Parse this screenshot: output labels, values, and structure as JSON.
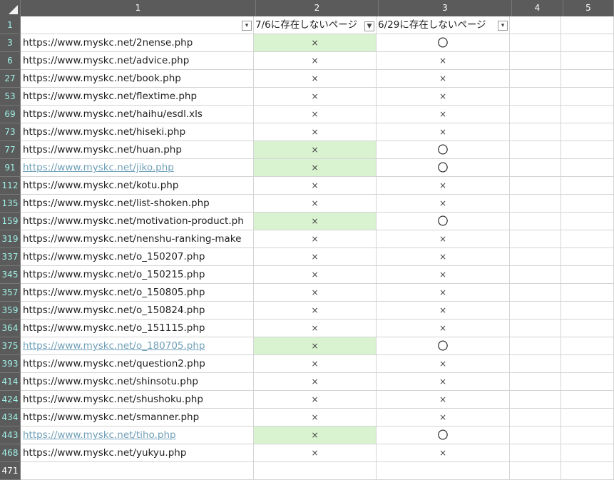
{
  "columns": [
    "1",
    "2",
    "3",
    "4",
    "5"
  ],
  "header_row": {
    "row_num": "1",
    "col2": "7/6に存在しないページ",
    "col3": "6/29に存在しないページ",
    "filter_icon": "▾",
    "filter_active_icon": "▼"
  },
  "rows": [
    {
      "num": "3",
      "url": "https://www.myskc.net/2nense.php",
      "c2": "×",
      "c3": "〇",
      "green": true,
      "link": false
    },
    {
      "num": "6",
      "url": "https://www.myskc.net/advice.php",
      "c2": "×",
      "c3": "×",
      "green": false,
      "link": false
    },
    {
      "num": "27",
      "url": "https://www.myskc.net/book.php",
      "c2": "×",
      "c3": "×",
      "green": false,
      "link": false
    },
    {
      "num": "53",
      "url": "https://www.myskc.net/flextime.php",
      "c2": "×",
      "c3": "×",
      "green": false,
      "link": false
    },
    {
      "num": "69",
      "url": "https://www.myskc.net/haihu/esdl.xls",
      "c2": "×",
      "c3": "×",
      "green": false,
      "link": false
    },
    {
      "num": "73",
      "url": "https://www.myskc.net/hiseki.php",
      "c2": "×",
      "c3": "×",
      "green": false,
      "link": false
    },
    {
      "num": "77",
      "url": "https://www.myskc.net/huan.php",
      "c2": "×",
      "c3": "〇",
      "green": true,
      "link": false
    },
    {
      "num": "91",
      "url": "https://www.myskc.net/jiko.php",
      "c2": "×",
      "c3": "〇",
      "green": true,
      "link": true
    },
    {
      "num": "112",
      "url": "https://www.myskc.net/kotu.php",
      "c2": "×",
      "c3": "×",
      "green": false,
      "link": false
    },
    {
      "num": "135",
      "url": "https://www.myskc.net/list-shoken.php",
      "c2": "×",
      "c3": "×",
      "green": false,
      "link": false
    },
    {
      "num": "159",
      "url": "https://www.myskc.net/motivation-product.ph",
      "c2": "×",
      "c3": "〇",
      "green": true,
      "link": false
    },
    {
      "num": "319",
      "url": "https://www.myskc.net/nenshu-ranking-make",
      "c2": "×",
      "c3": "×",
      "green": false,
      "link": false
    },
    {
      "num": "337",
      "url": "https://www.myskc.net/o_150207.php",
      "c2": "×",
      "c3": "×",
      "green": false,
      "link": false
    },
    {
      "num": "345",
      "url": "https://www.myskc.net/o_150215.php",
      "c2": "×",
      "c3": "×",
      "green": false,
      "link": false
    },
    {
      "num": "357",
      "url": "https://www.myskc.net/o_150805.php",
      "c2": "×",
      "c3": "×",
      "green": false,
      "link": false
    },
    {
      "num": "359",
      "url": "https://www.myskc.net/o_150824.php",
      "c2": "×",
      "c3": "×",
      "green": false,
      "link": false
    },
    {
      "num": "364",
      "url": "https://www.myskc.net/o_151115.php",
      "c2": "×",
      "c3": "×",
      "green": false,
      "link": false
    },
    {
      "num": "375",
      "url": "https://www.myskc.net/o_180705.php",
      "c2": "×",
      "c3": "〇",
      "green": true,
      "link": true
    },
    {
      "num": "393",
      "url": "https://www.myskc.net/question2.php",
      "c2": "×",
      "c3": "×",
      "green": false,
      "link": false
    },
    {
      "num": "414",
      "url": "https://www.myskc.net/shinsotu.php",
      "c2": "×",
      "c3": "×",
      "green": false,
      "link": false
    },
    {
      "num": "424",
      "url": "https://www.myskc.net/shushoku.php",
      "c2": "×",
      "c3": "×",
      "green": false,
      "link": false
    },
    {
      "num": "434",
      "url": "https://www.myskc.net/smanner.php",
      "c2": "×",
      "c3": "×",
      "green": false,
      "link": false
    },
    {
      "num": "443",
      "url": "https://www.myskc.net/tiho.php",
      "c2": "×",
      "c3": "〇",
      "green": true,
      "link": true
    },
    {
      "num": "468",
      "url": "https://www.myskc.net/yukyu.php",
      "c2": "×",
      "c3": "×",
      "green": false,
      "link": false
    },
    {
      "num": "471",
      "url": "",
      "c2": "",
      "c3": "",
      "green": false,
      "link": false,
      "plain": true
    }
  ],
  "colors": {
    "header_bg": "#5b5b5b",
    "row_number_text": "#9ff0e6",
    "highlight_green": "#d9f2d0",
    "hyperlink": "#6fa0b8"
  }
}
